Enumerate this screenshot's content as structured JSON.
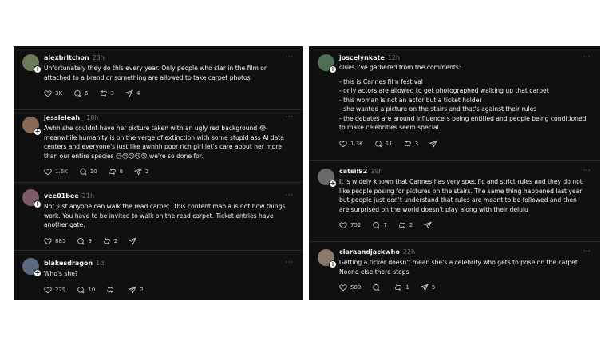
{
  "left": [
    {
      "username": "alexbritchon",
      "time": "23h",
      "lines": [
        "Unfortunately they do this every year. Only people who star in the film or",
        "attached to a brand or something are allowed to take carpet photos"
      ],
      "likes": "3K",
      "replies": "6",
      "reposts": "3",
      "shares": "4"
    },
    {
      "username": "jessieleah_",
      "time": "18h",
      "lines": [
        "Awhh she couldnt have her picture taken with an ugly red background 😭",
        "meanwhile humanity is on the verge of extinction with some stupid ass AI data",
        "centers and everyone's just like awhhh poor rich girl let's care about her more",
        "than our entire species 😕😕😕😕😕 we're so done for."
      ],
      "likes": "1.6K",
      "replies": "10",
      "reposts": "8",
      "shares": "2"
    },
    {
      "username": "vee01bee",
      "time": "21h",
      "lines": [
        "Not just anyone can walk the read carpet. This content mania is not how things",
        "work. You have to be invited to walk on the read carpet. Ticket entries have",
        "another gate."
      ],
      "likes": "885",
      "replies": "9",
      "reposts": "2",
      "shares": ""
    },
    {
      "username": "blakesdragon",
      "time": "1d",
      "lines": [
        "Who's she?"
      ],
      "likes": "279",
      "replies": "10",
      "reposts": "",
      "shares": "2"
    }
  ],
  "right": [
    {
      "username": "joscelynkate",
      "time": "12h",
      "lines": [
        "clues I've gathered from the comments:",
        "",
        "- this is Cannes film festival",
        "- only actors are allowed to get photographed walking up that carpet",
        "- this woman is not an actor but a ticket holder",
        "- she wanted a picture on the stairs and that's against their rules",
        "- the debates are around influencers being entitled and people being conditioned",
        "to make celebrities seem special"
      ],
      "likes": "1.3K",
      "replies": "11",
      "reposts": "3",
      "shares": ""
    },
    {
      "username": "catsil92",
      "time": "19h",
      "lines": [
        "It is widely known that Cannes has very specific and strict rules and they do not",
        "like people posing for pictures on the stairs. The same thing happened last year",
        "but people just don't understand that rules are meant to be followed and then",
        "are surprised on the world doesn't play along with their delulu"
      ],
      "likes": "752",
      "replies": "7",
      "reposts": "2",
      "shares": ""
    },
    {
      "username": "claraandjackwho",
      "time": "22h",
      "lines": [
        "Getting a ticker doesn't mean she's a celebrity who gets to pose on the carpet.",
        "Noone else there stops"
      ],
      "likes": "589",
      "replies": "",
      "reposts": "1",
      "shares": "5"
    }
  ],
  "more_label": "···",
  "icons": {
    "like": "heart-icon",
    "reply": "comment-icon",
    "repost": "repost-icon",
    "share": "share-icon",
    "more": "more-icon",
    "follow": "plus-icon"
  },
  "colors": {
    "panel_bg": "#101010",
    "text": "#f3f5f7",
    "muted": "#777777",
    "divider": "#2a2a2a"
  }
}
